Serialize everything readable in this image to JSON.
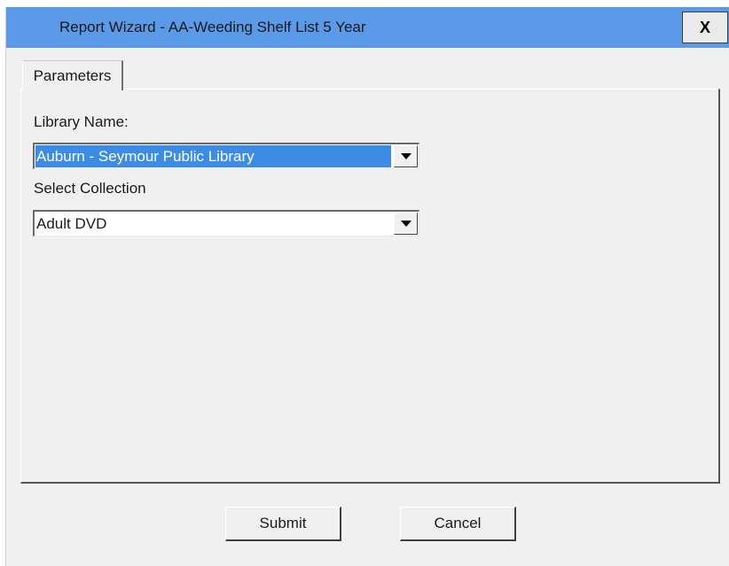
{
  "window": {
    "title": "Report Wizard - AA-Weeding Shelf List 5 Year",
    "close_label": "X"
  },
  "tabs": [
    {
      "label": "Parameters",
      "active": true
    }
  ],
  "parameters": {
    "library_name": {
      "label": "Library Name:",
      "value": "Auburn - Seymour Public Library",
      "selected": true
    },
    "collection": {
      "label": "Select Collection",
      "value": "Adult DVD"
    }
  },
  "buttons": {
    "submit_label": "Submit",
    "cancel_label": "Cancel"
  },
  "colors": {
    "titlebar": "#5b9ae8",
    "selection_highlight": "#3c8ce6",
    "window_background": "#f0f0f0"
  },
  "icons": {
    "dropdown": "chevron-down-icon"
  }
}
